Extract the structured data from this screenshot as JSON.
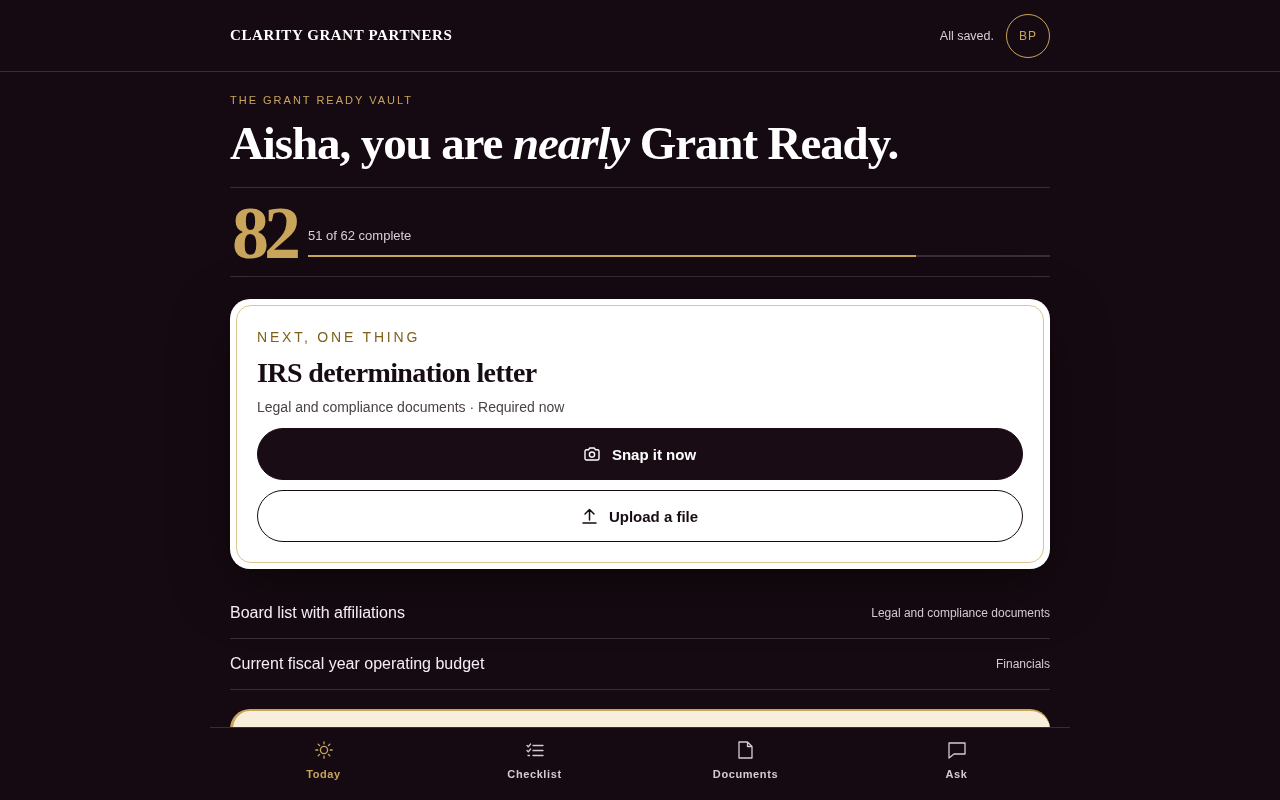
{
  "header": {
    "brand": "CLARITY GRANT PARTNERS",
    "save_status": "All saved.",
    "avatar_initials": "BP"
  },
  "hero": {
    "eyebrow": "THE GRANT READY VAULT",
    "title": "Aisha, you are *nearly* Grant Ready."
  },
  "score": {
    "value": "82",
    "caption": "51 of 62 complete",
    "level": 0.82
  },
  "next_item": {
    "eyebrow": "NEXT, ONE THING",
    "title": "IRS determination letter",
    "meta": "Legal and compliance documents · Required now",
    "actions": [
      {
        "kind": "snap",
        "label": "Snap it now",
        "primary": true
      },
      {
        "kind": "upload",
        "label": "Upload a file",
        "primary": false
      }
    ]
  },
  "queue": [
    {
      "title": "Board list with affiliations",
      "category": "Legal and compliance documents"
    },
    {
      "title": "Current fiscal year operating budget",
      "category": "Financials"
    }
  ],
  "nav": [
    {
      "kind": "today",
      "label": "Today",
      "selected": true
    },
    {
      "kind": "checklist",
      "label": "Checklist",
      "selected": false
    },
    {
      "kind": "documents",
      "label": "Documents",
      "selected": false
    },
    {
      "kind": "ask",
      "label": "Ask",
      "selected": false
    }
  ]
}
